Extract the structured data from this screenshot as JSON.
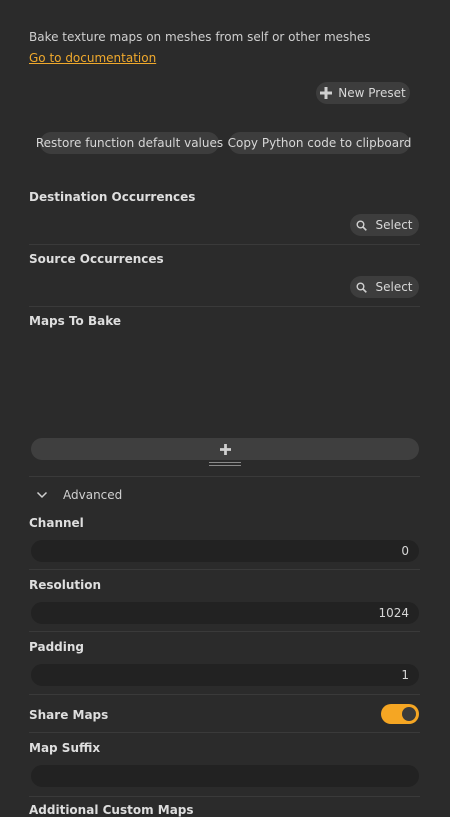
{
  "header": {
    "description": "Bake texture maps on meshes from self or other meshes",
    "doc_link": "Go to documentation"
  },
  "buttons": {
    "new_preset": "New Preset",
    "restore_defaults": "Restore function default values",
    "copy_python": "Copy Python code to clipboard"
  },
  "destination": {
    "label": "Destination Occurrences",
    "select": "Select"
  },
  "source": {
    "label": "Source Occurrences",
    "select": "Select"
  },
  "maps": {
    "label": "Maps To Bake"
  },
  "advanced": {
    "label": "Advanced"
  },
  "channel": {
    "label": "Channel",
    "value": "0"
  },
  "resolution": {
    "label": "Resolution",
    "value": "1024"
  },
  "padding": {
    "label": "Padding",
    "value": "1"
  },
  "share_maps": {
    "label": "Share Maps",
    "enabled": true
  },
  "map_suffix": {
    "label": "Map Suffix",
    "value": ""
  },
  "custom_maps": {
    "label": "Additional Custom Maps"
  },
  "colors": {
    "accent": "#f5a623",
    "link": "#f0a92c",
    "background": "#2b2b2b"
  },
  "icons": {
    "new_preset": "plus-icon",
    "select": "search-icon",
    "add_map": "plus-icon",
    "resize": "resize-handle-icon",
    "advanced": "chevron-down-icon"
  }
}
